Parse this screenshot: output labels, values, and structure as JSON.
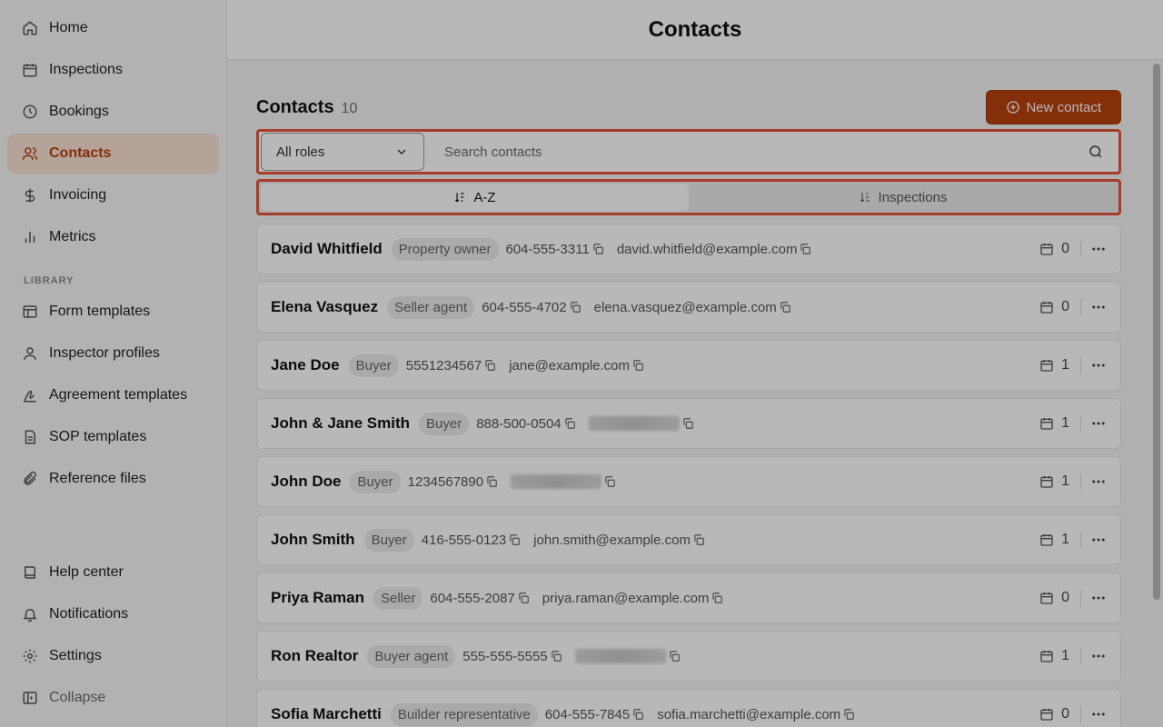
{
  "sidebar": {
    "items": [
      {
        "label": "Home",
        "icon": "home-icon"
      },
      {
        "label": "Inspections",
        "icon": "calendar-icon"
      },
      {
        "label": "Bookings",
        "icon": "clock-icon"
      },
      {
        "label": "Contacts",
        "icon": "users-icon",
        "active": true
      },
      {
        "label": "Invoicing",
        "icon": "dollar-icon"
      },
      {
        "label": "Metrics",
        "icon": "bar-chart-icon"
      }
    ],
    "library_label": "LIBRARY",
    "library_items": [
      {
        "label": "Form templates",
        "icon": "layout-icon"
      },
      {
        "label": "Inspector profiles",
        "icon": "user-icon"
      },
      {
        "label": "Agreement templates",
        "icon": "signature-icon"
      },
      {
        "label": "SOP templates",
        "icon": "file-icon"
      },
      {
        "label": "Reference files",
        "icon": "paperclip-icon"
      }
    ],
    "bottom_items": [
      {
        "label": "Help center",
        "icon": "book-icon"
      },
      {
        "label": "Notifications",
        "icon": "bell-icon"
      },
      {
        "label": "Settings",
        "icon": "gear-icon"
      },
      {
        "label": "Collapse",
        "icon": "sidebar-collapse-icon"
      }
    ]
  },
  "header": {
    "title": "Contacts"
  },
  "contacts": {
    "title": "Contacts",
    "count": "10",
    "new_button": "New contact",
    "role_filter": "All roles",
    "search_placeholder": "Search contacts",
    "sort": {
      "az": "A-Z",
      "inspections": "Inspections"
    },
    "rows": [
      {
        "name": "David Whitfield",
        "role": "Property owner",
        "phone": "604-555-3311",
        "email": "david.whitfield@example.com",
        "inspections": "0"
      },
      {
        "name": "Elena Vasquez",
        "role": "Seller agent",
        "phone": "604-555-4702",
        "email": "elena.vasquez@example.com",
        "inspections": "0"
      },
      {
        "name": "Jane Doe",
        "role": "Buyer",
        "phone": "5551234567",
        "email": "jane@example.com",
        "inspections": "1"
      },
      {
        "name": "John & Jane Smith",
        "role": "Buyer",
        "phone": "888-500-0504",
        "email": "",
        "inspections": "1"
      },
      {
        "name": "John Doe",
        "role": "Buyer",
        "phone": "1234567890",
        "email": "",
        "inspections": "1"
      },
      {
        "name": "John Smith",
        "role": "Buyer",
        "phone": "416-555-0123",
        "email": "john.smith@example.com",
        "inspections": "1"
      },
      {
        "name": "Priya Raman",
        "role": "Seller",
        "phone": "604-555-2087",
        "email": "priya.raman@example.com",
        "inspections": "0"
      },
      {
        "name": "Ron Realtor",
        "role": "Buyer agent",
        "phone": "555-555-5555",
        "email": "",
        "inspections": "1"
      },
      {
        "name": "Sofia Marchetti",
        "role": "Builder representative",
        "phone": "604-555-7845",
        "email": "sofia.marchetti@example.com",
        "inspections": "0"
      }
    ]
  },
  "colors": {
    "accent": "#b7410e",
    "highlight": "#e8553a"
  }
}
